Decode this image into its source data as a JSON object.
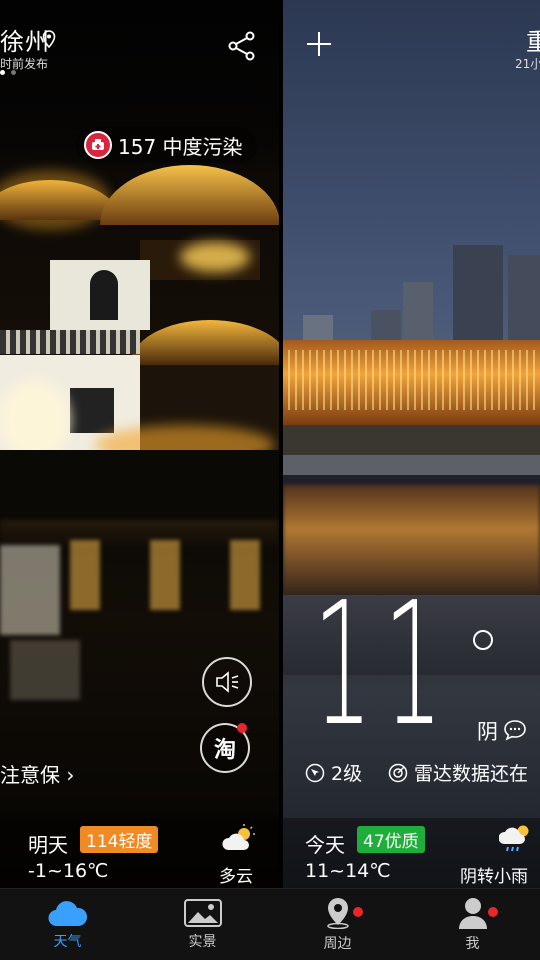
{
  "left": {
    "city": "徐州",
    "publish_time": "时前发布",
    "aqi": "157 中度污染",
    "notice": "注意保",
    "forecast": {
      "day": "明天",
      "aqi_badge": "114轻度",
      "temp": "-1~16℃",
      "weather": "多云"
    },
    "tao_label": "淘"
  },
  "right": {
    "city": "重",
    "publish_time": "21小",
    "temperature": "11",
    "condition": "阴",
    "wind": "2级",
    "radar": "雷达数据还在",
    "forecast": {
      "day": "今天",
      "aqi_badge": "47优质",
      "temp": "11~14℃",
      "weather": "阴转小雨"
    }
  },
  "nav": {
    "items": [
      {
        "label": "天气",
        "icon": "cloud-icon"
      },
      {
        "label": "实景",
        "icon": "photo-icon"
      },
      {
        "label": "周边",
        "icon": "map-pin-icon"
      },
      {
        "label": "我",
        "icon": "person-icon"
      }
    ]
  },
  "colors": {
    "accent": "#3aa0ff",
    "badge_mild": "#f08a24",
    "badge_good": "#1fae3b",
    "alert_red": "#e8262b"
  }
}
